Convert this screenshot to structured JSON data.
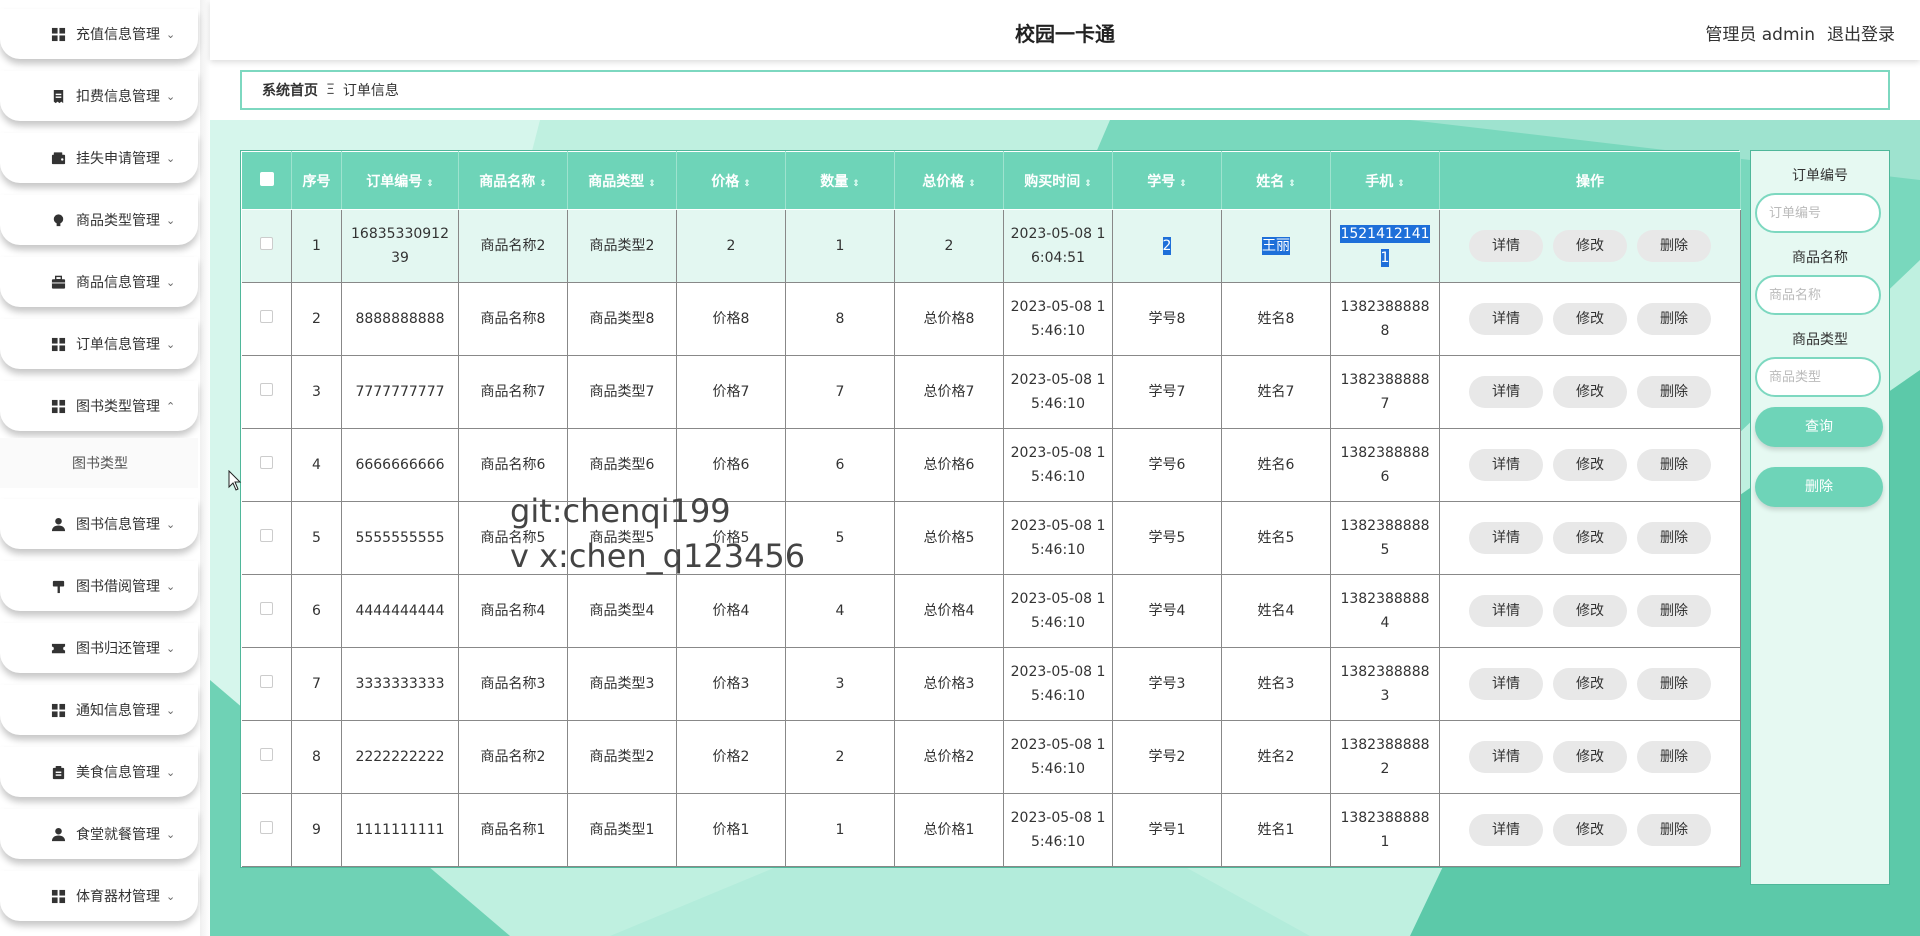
{
  "app": {
    "title": "校园一卡通"
  },
  "header": {
    "user": "管理员 admin",
    "logout": "退出登录"
  },
  "breadcrumb": {
    "home": "系统首页",
    "sep": "Ξ",
    "current": "订单信息"
  },
  "sidebar": {
    "items": [
      {
        "label": "充值信息管理",
        "icon": "grid-icon",
        "chev": "⌄"
      },
      {
        "label": "扣费信息管理",
        "icon": "receipt-icon",
        "chev": "⌄"
      },
      {
        "label": "挂失申请管理",
        "icon": "wallet-icon",
        "chev": "⌄"
      },
      {
        "label": "商品类型管理",
        "icon": "bulb-icon",
        "chev": "⌄"
      },
      {
        "label": "商品信息管理",
        "icon": "briefcase-icon",
        "chev": "⌄"
      },
      {
        "label": "订单信息管理",
        "icon": "grid-icon",
        "chev": "⌄"
      },
      {
        "label": "图书类型管理",
        "icon": "grid-icon",
        "chev": "⌃"
      },
      {
        "label": "图书信息管理",
        "icon": "user-icon",
        "chev": "⌄"
      },
      {
        "label": "图书借阅管理",
        "icon": "signpost-icon",
        "chev": "⌄"
      },
      {
        "label": "图书归还管理",
        "icon": "ticket-icon",
        "chev": "⌄"
      },
      {
        "label": "通知信息管理",
        "icon": "grid-icon",
        "chev": "⌄"
      },
      {
        "label": "美食信息管理",
        "icon": "clipboard-icon",
        "chev": "⌄"
      },
      {
        "label": "食堂就餐管理",
        "icon": "user-icon",
        "chev": "⌄"
      },
      {
        "label": "体育器材管理",
        "icon": "grid-icon",
        "chev": "⌄"
      }
    ],
    "submenu": {
      "label": "图书类型"
    }
  },
  "table": {
    "columns": [
      "",
      "序号",
      "订单编号",
      "商品名称",
      "商品类型",
      "价格",
      "数量",
      "总价格",
      "购买时间",
      "学号",
      "姓名",
      "手机",
      "操作"
    ],
    "sort_icon": "⇕",
    "actions": {
      "detail": "详情",
      "edit": "修改",
      "delete": "删除"
    },
    "rows": [
      {
        "no": "1",
        "order_no": "1683533091239",
        "name": "商品名称2",
        "type": "商品类型2",
        "price": "2",
        "qty": "1",
        "total": "2",
        "time": "2023-05-08 16:04:51",
        "sid": "2",
        "sname": "王丽",
        "phone": "15214121411"
      },
      {
        "no": "2",
        "order_no": "8888888888",
        "name": "商品名称8",
        "type": "商品类型8",
        "price": "价格8",
        "qty": "8",
        "total": "总价格8",
        "time": "2023-05-08 15:46:10",
        "sid": "学号8",
        "sname": "姓名8",
        "phone": "13823888888"
      },
      {
        "no": "3",
        "order_no": "7777777777",
        "name": "商品名称7",
        "type": "商品类型7",
        "price": "价格7",
        "qty": "7",
        "total": "总价格7",
        "time": "2023-05-08 15:46:10",
        "sid": "学号7",
        "sname": "姓名7",
        "phone": "13823888887"
      },
      {
        "no": "4",
        "order_no": "6666666666",
        "name": "商品名称6",
        "type": "商品类型6",
        "price": "价格6",
        "qty": "6",
        "total": "总价格6",
        "time": "2023-05-08 15:46:10",
        "sid": "学号6",
        "sname": "姓名6",
        "phone": "13823888886"
      },
      {
        "no": "5",
        "order_no": "5555555555",
        "name": "商品名称5",
        "type": "商品类型5",
        "price": "价格5",
        "qty": "5",
        "total": "总价格5",
        "time": "2023-05-08 15:46:10",
        "sid": "学号5",
        "sname": "姓名5",
        "phone": "13823888885"
      },
      {
        "no": "6",
        "order_no": "4444444444",
        "name": "商品名称4",
        "type": "商品类型4",
        "price": "价格4",
        "qty": "4",
        "total": "总价格4",
        "time": "2023-05-08 15:46:10",
        "sid": "学号4",
        "sname": "姓名4",
        "phone": "13823888884"
      },
      {
        "no": "7",
        "order_no": "3333333333",
        "name": "商品名称3",
        "type": "商品类型3",
        "price": "价格3",
        "qty": "3",
        "total": "总价格3",
        "time": "2023-05-08 15:46:10",
        "sid": "学号3",
        "sname": "姓名3",
        "phone": "13823888883"
      },
      {
        "no": "8",
        "order_no": "2222222222",
        "name": "商品名称2",
        "type": "商品类型2",
        "price": "价格2",
        "qty": "2",
        "total": "总价格2",
        "time": "2023-05-08 15:46:10",
        "sid": "学号2",
        "sname": "姓名2",
        "phone": "13823888882"
      },
      {
        "no": "9",
        "order_no": "1111111111",
        "name": "商品名称1",
        "type": "商品类型1",
        "price": "价格1",
        "qty": "1",
        "total": "总价格1",
        "time": "2023-05-08 15:46:10",
        "sid": "学号1",
        "sname": "姓名1",
        "phone": "13823888881"
      }
    ]
  },
  "search": {
    "order_no_label": "订单编号",
    "order_no_placeholder": "订单编号",
    "name_label": "商品名称",
    "name_placeholder": "商品名称",
    "type_label": "商品类型",
    "type_placeholder": "商品类型",
    "query_button": "查询",
    "delete_button": "删除"
  },
  "watermark": {
    "line1": "git:chenqi199",
    "line2": "v x:chen_q123456"
  },
  "colors": {
    "accent": "#6ed4b8",
    "accent_border": "#7dd8c0",
    "content_bg": "#c8f2e5",
    "selection": "#1e6fd9"
  }
}
